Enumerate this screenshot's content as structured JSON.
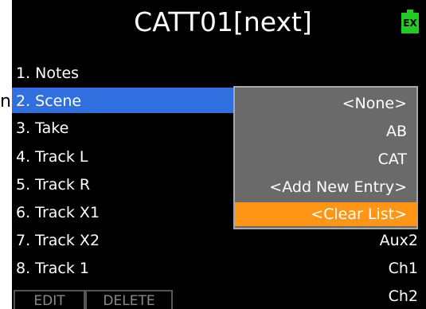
{
  "edge_glyph": "n",
  "header": {
    "title": "CATT01[next]",
    "badge": "EX",
    "badge_color": "#22cc22"
  },
  "fields": [
    {
      "label": "1. Notes",
      "value": ""
    },
    {
      "label": "2. Scene",
      "value": ""
    },
    {
      "label": "3. Take",
      "value": ""
    },
    {
      "label": "4. Track L",
      "value": ""
    },
    {
      "label": "5. Track R",
      "value": ""
    },
    {
      "label": "6. Track X1",
      "value": ""
    },
    {
      "label": "7. Track X2",
      "value": "Aux2"
    },
    {
      "label": "8. Track 1",
      "value": "Ch1"
    }
  ],
  "extra_value": "Ch2",
  "popup": {
    "options": [
      "<None>",
      "AB",
      "CAT",
      "<Add New Entry>",
      "<Clear List>"
    ],
    "highlight_color": "#ff9514"
  },
  "softkeys": {
    "edit": "EDIT",
    "delete": "DELETE"
  },
  "colors": {
    "selection": "#2f6fdf",
    "background": "#000000",
    "popup_bg": "#6a6a6a"
  }
}
